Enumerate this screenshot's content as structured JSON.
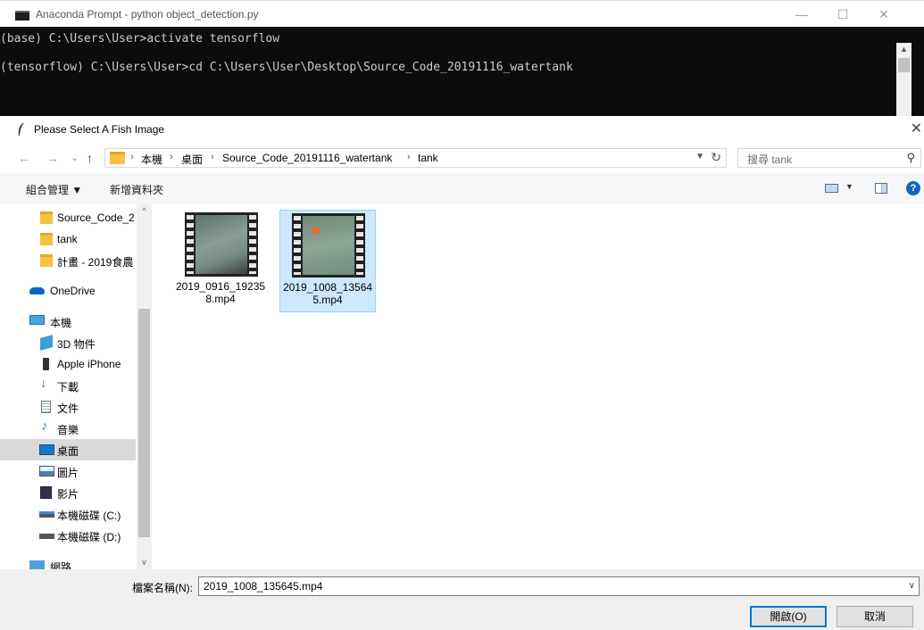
{
  "console": {
    "title": "Anaconda Prompt - python  object_detection.py",
    "lines": [
      "(base) C:\\Users\\User>activate tensorflow",
      "(tensorflow) C:\\Users\\User>cd C:\\Users\\User\\Desktop\\Source_Code_20191116_watertank"
    ],
    "minimize": "—",
    "maximize": "☐",
    "close": "✕"
  },
  "dialog": {
    "title": "Please Select A Fish Image",
    "close": "✕",
    "nav": {
      "back": "←",
      "forward": "→",
      "recent": "⌄",
      "up": "↑"
    },
    "breadcrumbs": [
      "本機",
      "桌面",
      "Source_Code_20191116_watertank",
      "tank"
    ],
    "breadcrumb_sep": "›",
    "search_placeholder": "搜尋 tank",
    "toolbar": {
      "organize": "組合管理 ▼",
      "new_folder": "新增資料夾",
      "help": "?"
    },
    "nav_pane": [
      {
        "label": "Source_Code_2",
        "icon": "folder-icon"
      },
      {
        "label": "tank",
        "icon": "folder-icon"
      },
      {
        "label": "計畫 - 2019食農",
        "icon": "folder-icon"
      },
      {
        "label": "OneDrive",
        "icon": "onedrive-icon"
      },
      {
        "label": "本機",
        "icon": "computer-icon"
      },
      {
        "label": "3D 物件",
        "icon": "3d-objects-icon"
      },
      {
        "label": "Apple iPhone",
        "icon": "phone-icon"
      },
      {
        "label": "下載",
        "icon": "download-icon"
      },
      {
        "label": "文件",
        "icon": "documents-icon"
      },
      {
        "label": "音樂",
        "icon": "music-icon"
      },
      {
        "label": "桌面",
        "icon": "desktop-icon",
        "selected": true
      },
      {
        "label": "圖片",
        "icon": "pictures-icon"
      },
      {
        "label": "影片",
        "icon": "videos-icon"
      },
      {
        "label": "本機磁碟 (C:)",
        "icon": "drive-c-icon"
      },
      {
        "label": "本機磁碟 (D:)",
        "icon": "drive-d-icon"
      },
      {
        "label": "網路",
        "icon": "network-icon"
      }
    ],
    "files": [
      {
        "name": "2019_0916_192358.mp4",
        "selected": false
      },
      {
        "name": "2019_1008_135645.mp4",
        "selected": true
      }
    ],
    "filename_label": "檔案名稱(N):",
    "filename_value": "2019_1008_135645.mp4",
    "open_button": "開啟(O)",
    "cancel_button": "取消"
  }
}
